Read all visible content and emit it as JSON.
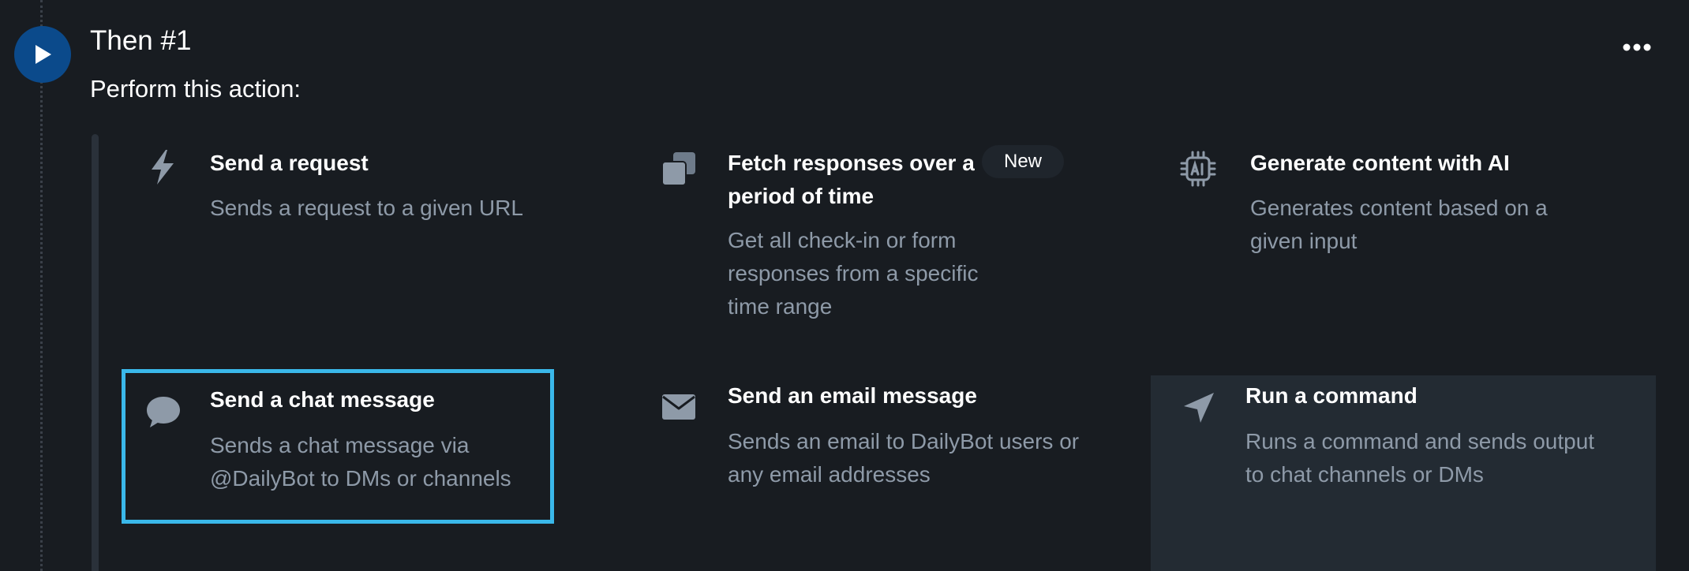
{
  "step": {
    "title": "Then #1",
    "subtitle": "Perform this action:",
    "icon": "play-icon",
    "menu_icon": "more-horizontal-icon"
  },
  "colors": {
    "background": "#181c21",
    "step_circle": "#0b4a8b",
    "selected_border": "#3ab8ea",
    "hover_background": "#232b33",
    "description_text": "#8e9aa8",
    "icon": "#8e9aa8"
  },
  "actions": [
    {
      "title": "Send a request",
      "description": "Sends a request to a given URL",
      "icon": "lightning-bolt-icon"
    },
    {
      "title": "Fetch responses over a period of time",
      "description": "Get all check-in or form responses from a specific time range",
      "icon": "stacked-squares-icon",
      "badge": "New"
    },
    {
      "title": "Generate content with AI",
      "description": "Generates content based on a given input",
      "icon": "ai-chip-icon"
    },
    {
      "title": "Send a chat message",
      "description": "Sends a chat message via @DailyBot to DMs or channels",
      "icon": "chat-bubble-icon",
      "state": "selected"
    },
    {
      "title": "Send an email message",
      "description": "Sends an email to DailyBot users or any email addresses",
      "icon": "envelope-icon"
    },
    {
      "title": "Run a command",
      "description": "Runs a command and sends output to chat channels or DMs",
      "icon": "navigation-arrow-icon",
      "state": "hovered"
    }
  ]
}
